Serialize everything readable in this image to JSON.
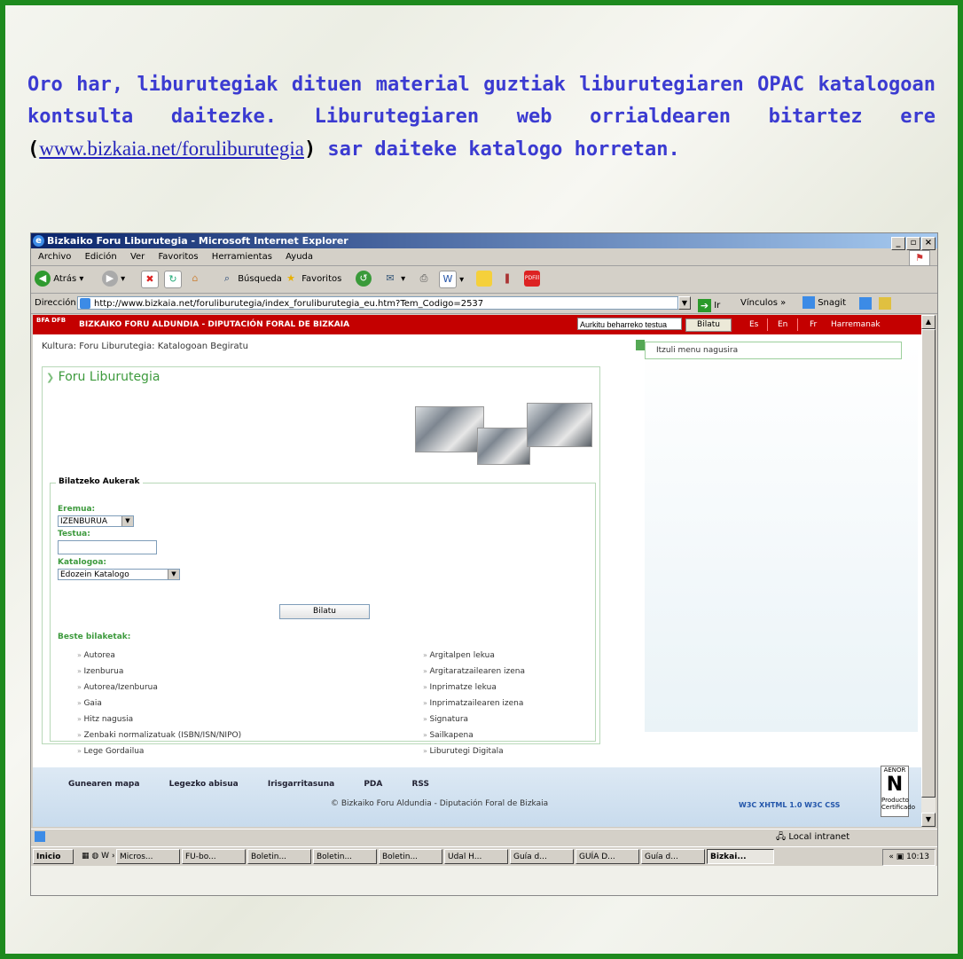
{
  "intro": {
    "before_link": "Oro har, liburutegiak dituen material guztiak liburutegiaren OPAC katalogoan kontsulta daitezke. Liburutegiaren web orrialdearen bitartez ere ",
    "open_paren": "(",
    "link": "www.bizkaia.net/foruliburutegia",
    "close_paren": ")",
    "after_link": " sar daiteke katalogo horretan."
  },
  "window": {
    "title": "Bizkaiko Foru Liburutegia - Microsoft Internet Explorer",
    "buttons": [
      "_",
      "▫",
      "×"
    ]
  },
  "menubar": [
    "Archivo",
    "Edición",
    "Ver",
    "Favoritos",
    "Herramientas",
    "Ayuda"
  ],
  "toolbar": {
    "back": "Atrás",
    "search": "Búsqueda",
    "favorites": "Favoritos",
    "pdf": "PDFill"
  },
  "address": {
    "label": "Dirección",
    "url": "http://www.bizkaia.net/foruliburutegia/index_foruliburutegia_eu.htm?Tem_Codigo=2537",
    "go": "Ir",
    "links": "Vínculos",
    "snagit": "Snagit"
  },
  "site": {
    "logo": "BFA DFB",
    "brand": "BIZKAIKO FORU ALDUNDIA - DIPUTACIÓN FORAL DE BIZKAIA",
    "search_value": "Aurkitu beharreko testua",
    "search_button": "Bilatu",
    "langs": [
      "Es",
      "En",
      "Fr"
    ],
    "contact": "Harremanak",
    "breadcrumb": "Kultura: Foru Liburutegia: Katalogoan Begiratu",
    "panel_title": "Foru Liburutegia",
    "back_menu": "Itzuli menu nagusira"
  },
  "search_form": {
    "legend": "Bilatzeko Aukerak",
    "field1_label": "Eremua:",
    "field1_value": "IZENBURUA",
    "field2_label": "Testua:",
    "field2_value": "",
    "field3_label": "Katalogoa:",
    "field3_value": "Edozein Katalogo",
    "submit": "Bilatu",
    "other_label": "Beste bilaketak:",
    "links_left": [
      "Autorea",
      "Izenburua",
      "Autorea/Izenburua",
      "Gaia",
      "Hitz nagusia",
      "Zenbaki normalizatuak (ISBN/ISN/NIPO)",
      "Lege Gordailua"
    ],
    "links_right": [
      "Argitalpen lekua",
      "Argitaratzailearen izena",
      "Inprimatze lekua",
      "Inprimatzailearen izena",
      "Signatura",
      "Sailkapena",
      "Liburutegi Digitala"
    ]
  },
  "footer": {
    "links": [
      "Gunearen mapa",
      "Legezko abisua",
      "Irisgarritasuna",
      "PDA",
      "RSS"
    ],
    "copyright": "© Bizkaiko Foru Aldundia - Diputación Foral de Bizkaia",
    "badges": "W3C XHTML 1.0  W3C CSS",
    "aenor_top": "AENOR",
    "aenor_bottom": "Producto Certificado"
  },
  "status": {
    "zone": "Local intranet"
  },
  "taskbar": {
    "start": "Inicio",
    "tasks": [
      "Micros...",
      "FU-bo...",
      "Boletin...",
      "Boletin...",
      "Boletin...",
      "Udal H...",
      "Guía d...",
      "GUÍA D...",
      "Guía d...",
      "Bizkai..."
    ],
    "time": "10:13"
  }
}
